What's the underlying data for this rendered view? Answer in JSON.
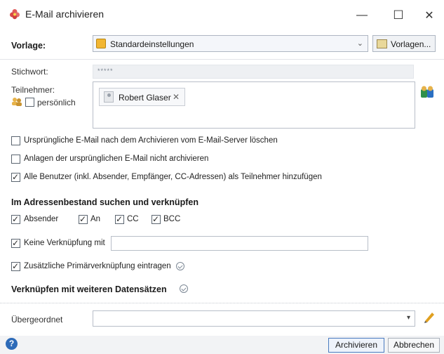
{
  "window": {
    "title": "E-Mail archivieren",
    "minimize_glyph": "—",
    "maximize_glyph": "☐",
    "close_glyph": "✕"
  },
  "vorlage": {
    "label": "Vorlage:",
    "value": "Standardeinstellungen",
    "dropdown_glyph": "⌄",
    "button_label": "Vorlagen..."
  },
  "stichwort": {
    "label": "Stichwort:",
    "placeholder": "*****"
  },
  "teilnehmer": {
    "label": "Teilnehmer:",
    "persoenlich_label": "persönlich",
    "persoenlich_checked": false,
    "participants": [
      {
        "name": "Robert Glaser",
        "remove_glyph": "✕"
      }
    ]
  },
  "options": [
    {
      "label": "Ursprüngliche E-Mail nach dem Archivieren vom E-Mail-Server löschen",
      "checked": false
    },
    {
      "label": "Anlagen der ursprünglichen E-Mail nicht archivieren",
      "checked": false
    },
    {
      "label": "Alle Benutzer (inkl. Absender, Empfänger, CC-Adressen) als Teilnehmer hinzufügen",
      "checked": true
    }
  ],
  "address_section": {
    "title": "Im Adressenbestand suchen und verknüpfen",
    "fields": [
      {
        "label": "Absender",
        "checked": true
      },
      {
        "label": "An",
        "checked": true
      },
      {
        "label": "CC",
        "checked": true
      },
      {
        "label": "BCC",
        "checked": true
      }
    ],
    "keine_label": "Keine Verknüpfung mit",
    "keine_checked": true,
    "keine_value": "",
    "primaer_label": "Zusätzliche Primärverknüpfung eintragen",
    "primaer_checked": true
  },
  "link_section": {
    "title": "Verknüpfen mit weiteren Datensätzen"
  },
  "uebergeordnet": {
    "label": "Übergeordnet",
    "value": "",
    "dropdown_glyph": "▾"
  },
  "footer": {
    "help_glyph": "?",
    "archive_label": "Archivieren",
    "cancel_label": "Abbrechen"
  },
  "colors": {
    "accent": "#2e6bb8",
    "folder_icon": "#f2b632",
    "pencil": "#e0a020"
  }
}
